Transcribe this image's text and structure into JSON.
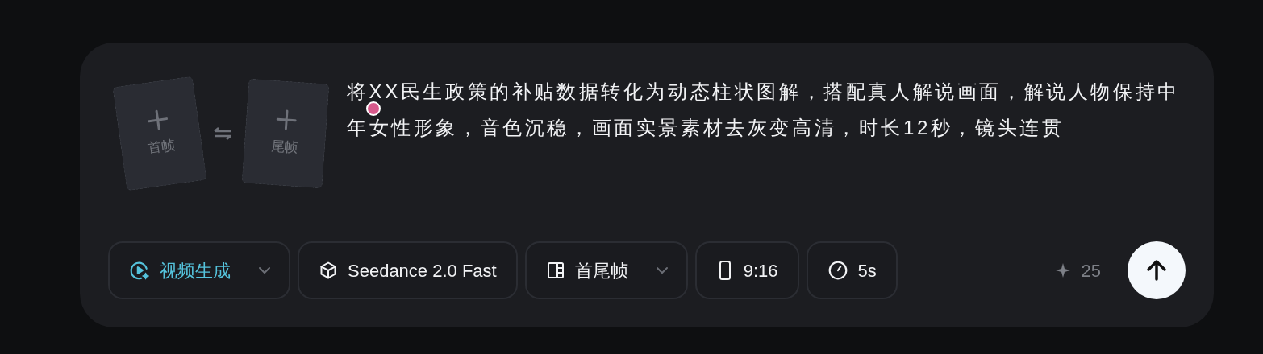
{
  "frames": [
    {
      "label": "首帧"
    },
    {
      "label": "尾帧"
    }
  ],
  "prompt": "将XX民生政策的补贴数据转化为动态柱状图解，搭配真人解说画面，解说人物保持中年女性形象，音色沉稳，画面实景素材去灰变高清，时长12秒，镜头连贯",
  "toolbar": [
    {
      "kind": "mode",
      "label": "视频生成",
      "dropdown": true
    },
    {
      "kind": "model",
      "label": "Seedance 2.0 Fast",
      "dropdown": false
    },
    {
      "kind": "frames",
      "label": "首尾帧",
      "dropdown": true
    },
    {
      "kind": "ratio",
      "label": "9:16",
      "dropdown": false
    },
    {
      "kind": "duration",
      "label": "5s",
      "dropdown": false
    }
  ],
  "credits": "25"
}
